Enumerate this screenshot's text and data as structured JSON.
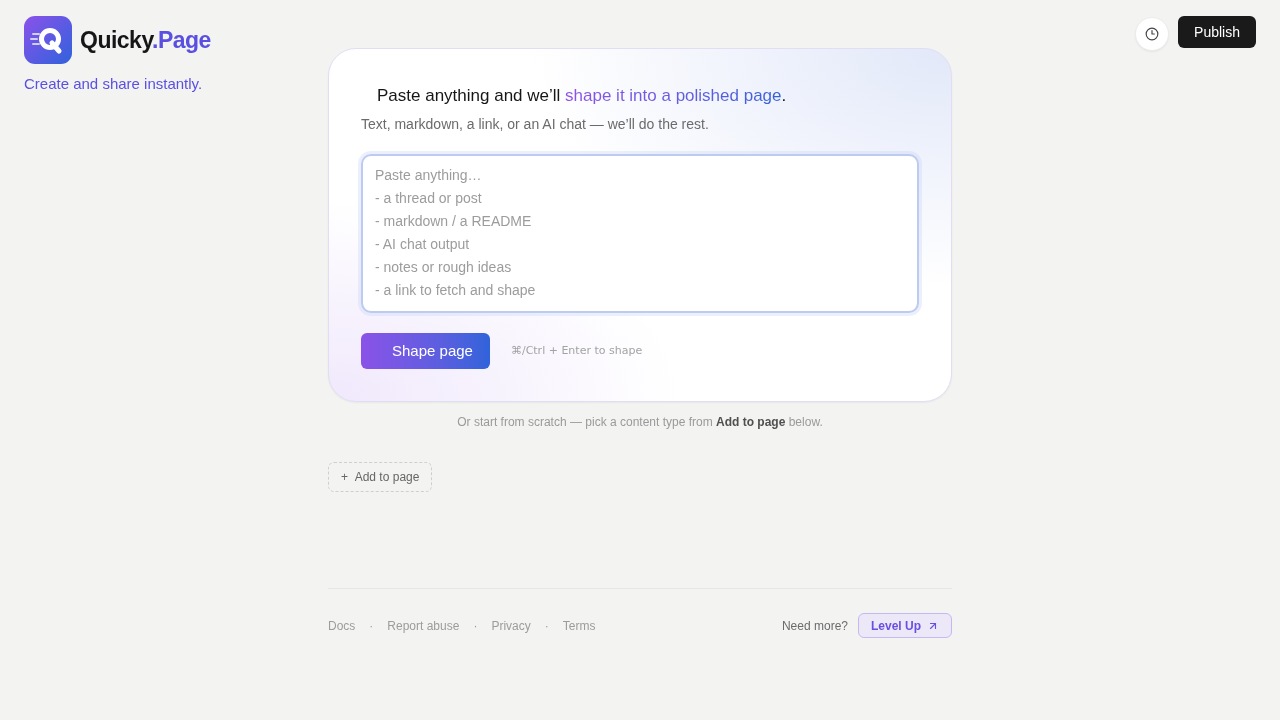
{
  "brand": {
    "name": "Quicky",
    "suffix": ".Page",
    "tagline": "Create and share instantly."
  },
  "header_actions": {
    "publish": "Publish"
  },
  "composer": {
    "heading": {
      "lead": "Paste anything and we’ll ",
      "highlight": "shape it into a polished page",
      "tail": "."
    },
    "subtitle": "Text, markdown, a link, or an AI chat — we’ll do the rest.",
    "input": {
      "placeholder": "Paste anything…\n- a thread or post\n- markdown / a README\n- AI chat output\n- notes or rough ideas\n- a link to fetch and shape"
    },
    "submit": "Shape page",
    "shortcut_hint": "⌘/Ctrl + Enter to shape"
  },
  "scratch_note": "Or start from scratch — pick a content type from **Add to page** below.",
  "add_button": {
    "symbol": "+",
    "label": "Add to page"
  },
  "footer": {
    "links": [
      "Docs",
      "Report abuse",
      "Privacy",
      "Terms"
    ],
    "separators": [
      "·",
      "·",
      "·"
    ],
    "prompt": "Need more?",
    "upgrade": "Level Up"
  }
}
